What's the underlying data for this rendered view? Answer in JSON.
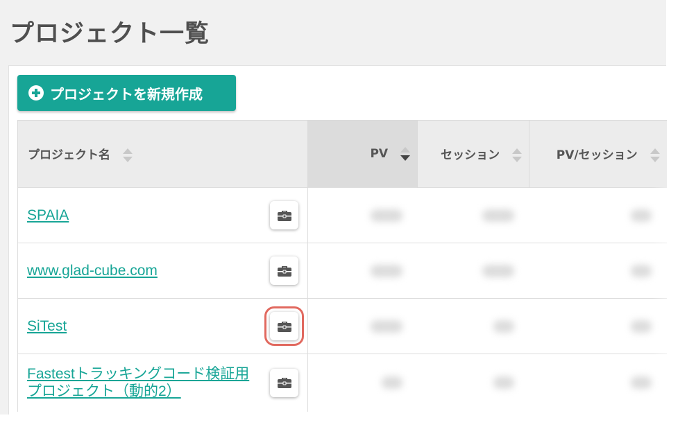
{
  "page": {
    "title": "プロジェクト一覧"
  },
  "toolbar": {
    "new_project_label": "プロジェクトを新規作成"
  },
  "table": {
    "columns": [
      {
        "label": "プロジェクト名",
        "sort": "none"
      },
      {
        "label": "PV",
        "sort": "desc"
      },
      {
        "label": "セッション",
        "sort": "none"
      },
      {
        "label": "PV/セッション",
        "sort": "none"
      }
    ],
    "rows": [
      {
        "name": "SPAIA"
      },
      {
        "name": "www.glad-cube.com"
      },
      {
        "name": "SiTest"
      },
      {
        "name": "Fastestトラッキングコード検証用プロジェクト（動的2）"
      }
    ],
    "highlighted_row": 2
  },
  "icons": {
    "new_project": "plus-circle-icon",
    "row_action": "briefcase-icon"
  },
  "colors": {
    "accent": "#17a596",
    "highlight": "#e1695f"
  }
}
